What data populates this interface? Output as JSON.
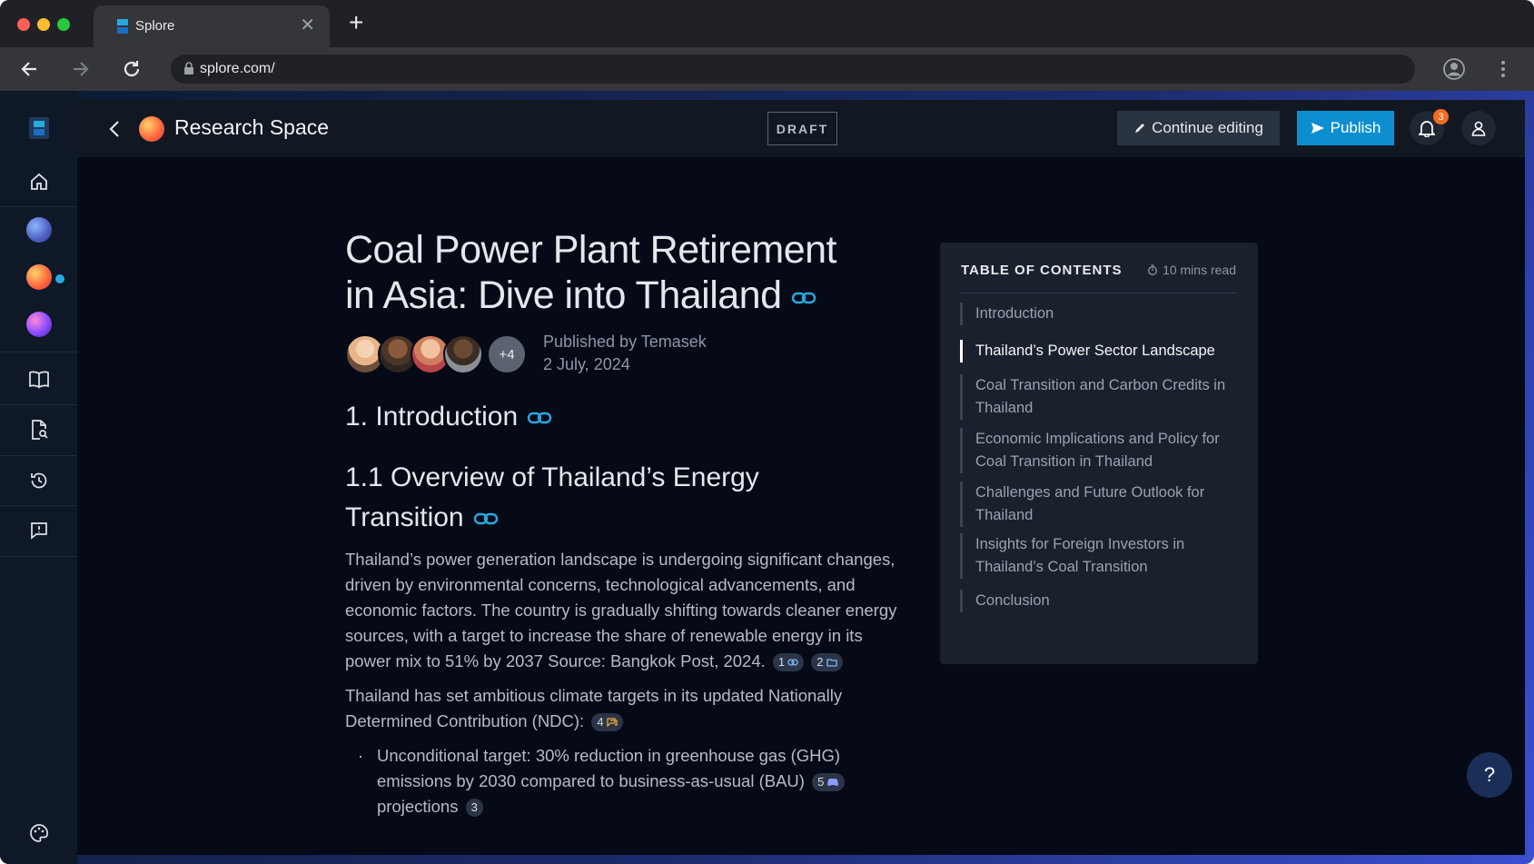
{
  "browser": {
    "tab_title": "Splore",
    "url": "splore.com/"
  },
  "header": {
    "space_title": "Research Space",
    "status_badge": "DRAFT",
    "edit_label": "Continue editing",
    "publish_label": "Publish",
    "notification_count": "3"
  },
  "article": {
    "title_line1": "Coal Power Plant Retirement",
    "title_line2": "in Asia: Dive into Thailand",
    "more_authors": "+4",
    "published_by": "Published by Temasek",
    "date": "2 July, 2024",
    "h2": "1. Introduction",
    "h3_line1": "1.1 Overview of Thailand’s Energy",
    "h3_line2": "Transition",
    "para1": "Thailand’s power generation landscape is undergoing significant changes, driven by environmental concerns, technological advancements, and economic factors. The country is gradually shifting towards cleaner energy sources, with a target to increase the share of renewable energy in its power mix to 51% by 2037 Source: Bangkok Post, 2024.",
    "para1_cite1": "1",
    "para1_cite2": "2",
    "para2": "Thailand has set ambitious climate targets in its updated Nationally Determined Contribution (NDC):",
    "para2_cite": "4",
    "bullet1": "Unconditional target: 30% reduction in greenhouse gas (GHG) emissions by 2030 compared to business-as-usual (BAU)",
    "bullet1_cite": "5",
    "bullet1_cont": "projections",
    "bullet1_cont_cite": "3"
  },
  "toc": {
    "heading": "TABLE OF CONTENTS",
    "read_time": "10 mins read",
    "items": [
      {
        "label": "Introduction",
        "active": false
      },
      {
        "label": "Thailand’s Power Sector Landscape",
        "active": true
      },
      {
        "label": "Coal Transition and Carbon Credits in Thailand",
        "active": false
      },
      {
        "label": "Economic Implications and Policy for Coal Transition in Thailand",
        "active": false
      },
      {
        "label": "Challenges and Future Outlook for Thailand",
        "active": false
      },
      {
        "label": "Insights for Foreign Investors in Thailand’s Coal Transition",
        "active": false
      },
      {
        "label": "Conclusion",
        "active": false
      }
    ]
  },
  "help_label": "?",
  "colors": {
    "accent": "#0e8ed1",
    "badge": "#f36b21",
    "background": "#050a16"
  }
}
